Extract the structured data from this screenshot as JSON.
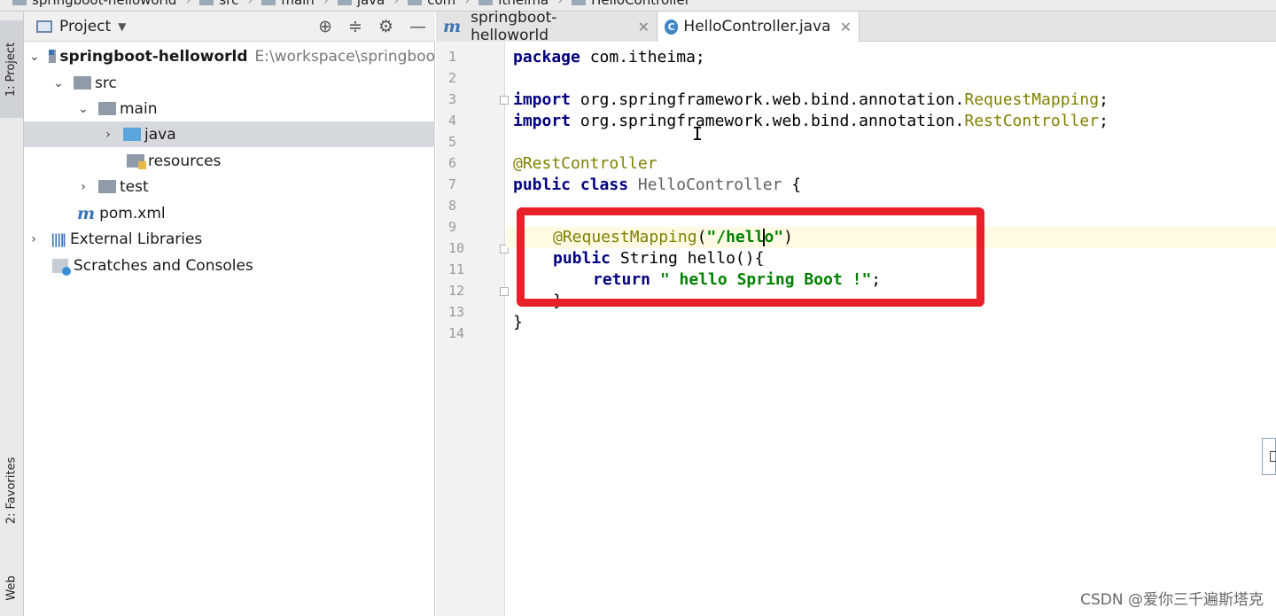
{
  "breadcrumb": {
    "items": [
      "springboot-helloworld",
      "src",
      "main",
      "java",
      "com",
      "itheima",
      "HelloController"
    ]
  },
  "left_strip": {
    "project_tab": "1: Project",
    "favorites_tab": "2: Favorites",
    "web_tab": "Web"
  },
  "project_panel": {
    "title": "Project",
    "tree": [
      {
        "label": "springboot-helloworld",
        "path": "E:\\workspace\\springboo"
      },
      {
        "label": "src"
      },
      {
        "label": "main"
      },
      {
        "label": "java"
      },
      {
        "label": "resources"
      },
      {
        "label": "test"
      },
      {
        "label": "pom.xml"
      },
      {
        "label": "External Libraries"
      },
      {
        "label": "Scratches and Consoles"
      }
    ]
  },
  "editor": {
    "tabs": [
      {
        "label": "springboot-helloworld"
      },
      {
        "label": "HelloController.java"
      }
    ],
    "line_numbers": [
      "1",
      "2",
      "3",
      "4",
      "5",
      "6",
      "7",
      "8",
      "9",
      "10",
      "11",
      "12",
      "13",
      "14"
    ],
    "code": {
      "l1_kw": "package",
      "l1_rest": " com.itheima;",
      "l3_kw": "import",
      "l3_pkg": " org.springframework.web.bind.annotation.",
      "l3_cls": "RequestMapping",
      "l3_end": ";",
      "l4_kw": "import",
      "l4_pkg": " org.springframework.web.bind.annotation.",
      "l4_cls": "RestController",
      "l4_end": ";",
      "l6_ann": "@RestController",
      "l7_kw": "public class",
      "l7_name": " HelloController",
      "l7_end": " {",
      "l9_ann": "@RequestMapping",
      "l9_open": "(",
      "l9_str_a": "\"/hell",
      "l9_str_b": "o\"",
      "l9_close": ")",
      "l10_kw": "public",
      "l10_rest": " String hello(){",
      "l11_kw": "return",
      "l11_str": " \" hello Spring Boot !\"",
      "l11_end": ";",
      "l12": "}",
      "l13": "}"
    }
  },
  "watermark": "CSDN @爱你三千遍斯塔克",
  "colors": {
    "highlight_box": "#e8202a",
    "keyword": "#000080",
    "annotation": "#808000",
    "string": "#008000",
    "current_line": "#fffae3"
  }
}
